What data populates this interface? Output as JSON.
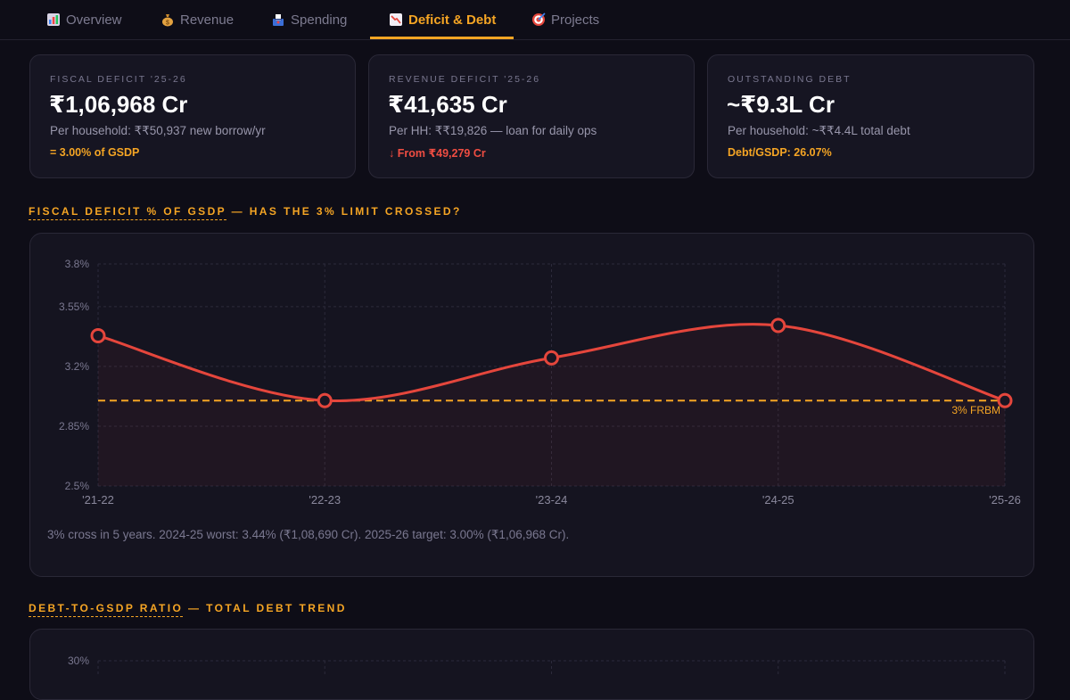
{
  "tabs": [
    {
      "label": "Overview",
      "icon": "bar-chart-icon",
      "active": false
    },
    {
      "label": "Revenue",
      "icon": "money-bag-icon",
      "active": false
    },
    {
      "label": "Spending",
      "icon": "ballot-box-icon",
      "active": false
    },
    {
      "label": "Deficit & Debt",
      "icon": "chart-decreasing-icon",
      "active": true
    },
    {
      "label": "Projects",
      "icon": "target-icon",
      "active": false
    }
  ],
  "cards": [
    {
      "label": "FISCAL DEFICIT '25-26",
      "value": "₹1,06,968 Cr",
      "sub": "Per household: ₹₹50,937 new borrow/yr",
      "note": "= 3.00% of GSDP"
    },
    {
      "label": "REVENUE DEFICIT '25-26",
      "value": "₹41,635 Cr",
      "sub": "Per HH: ₹₹19,826 — loan for daily ops",
      "note": "↓ From ₹49,279 Cr"
    },
    {
      "label": "OUTSTANDING DEBT",
      "value": "~₹9.3L Cr",
      "sub": "Per household: ~₹₹4.4L total debt",
      "note": "Debt/GSDP: 26.07%"
    }
  ],
  "sections": {
    "deficit_title_underlined": "FISCAL DEFICIT % OF GSDP",
    "deficit_title_rest": " — HAS THE 3% LIMIT CROSSED?",
    "debt_title_underlined": "DEBT-TO-GSDP RATIO",
    "debt_title_rest": " — TOTAL DEBT TREND"
  },
  "caption": "3% cross in 5 years. 2024-25 worst: 3.44% (₹1,08,690 Cr). 2025-26 target: 3.00% (₹1,06,968 Cr).",
  "colors": {
    "accent": "#f5a524",
    "line": "#e5463c",
    "danger": "#ef4d42"
  },
  "chart_data": [
    {
      "type": "line",
      "x": [
        "'21-22",
        "'22-23",
        "'23-24",
        "'24-25",
        "'25-26"
      ],
      "series": [
        {
          "values": [
            3.38,
            3.0,
            3.25,
            3.44,
            3.0
          ]
        }
      ],
      "ylim": [
        2.5,
        3.8
      ],
      "yticks": [
        "3.8%",
        "3.55%",
        "3.2%",
        "2.85%",
        "2.5%"
      ],
      "ytick_values": [
        3.8,
        3.55,
        3.2,
        2.85,
        2.5
      ],
      "reference_line": {
        "value": 3.0,
        "label": "3% FRBM"
      },
      "grid": true
    },
    {
      "type": "line",
      "yticks": [
        "30%"
      ],
      "ytick_values": [
        30
      ]
    }
  ]
}
